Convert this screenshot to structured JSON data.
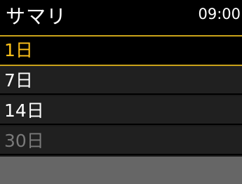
{
  "header": {
    "title": "サマリ",
    "time": "09:00"
  },
  "menu": {
    "items": [
      {
        "label": "1日",
        "state": "selected"
      },
      {
        "label": "7日",
        "state": "enabled"
      },
      {
        "label": "14日",
        "state": "enabled"
      },
      {
        "label": "30日",
        "state": "disabled"
      }
    ]
  },
  "colors": {
    "selected_text": "#ffc21a",
    "selected_border": "#c9a21a",
    "normal_text": "#ffffff",
    "disabled_text": "#7a7a7a",
    "row_bg": "#202020",
    "footer_bg": "#666666"
  }
}
